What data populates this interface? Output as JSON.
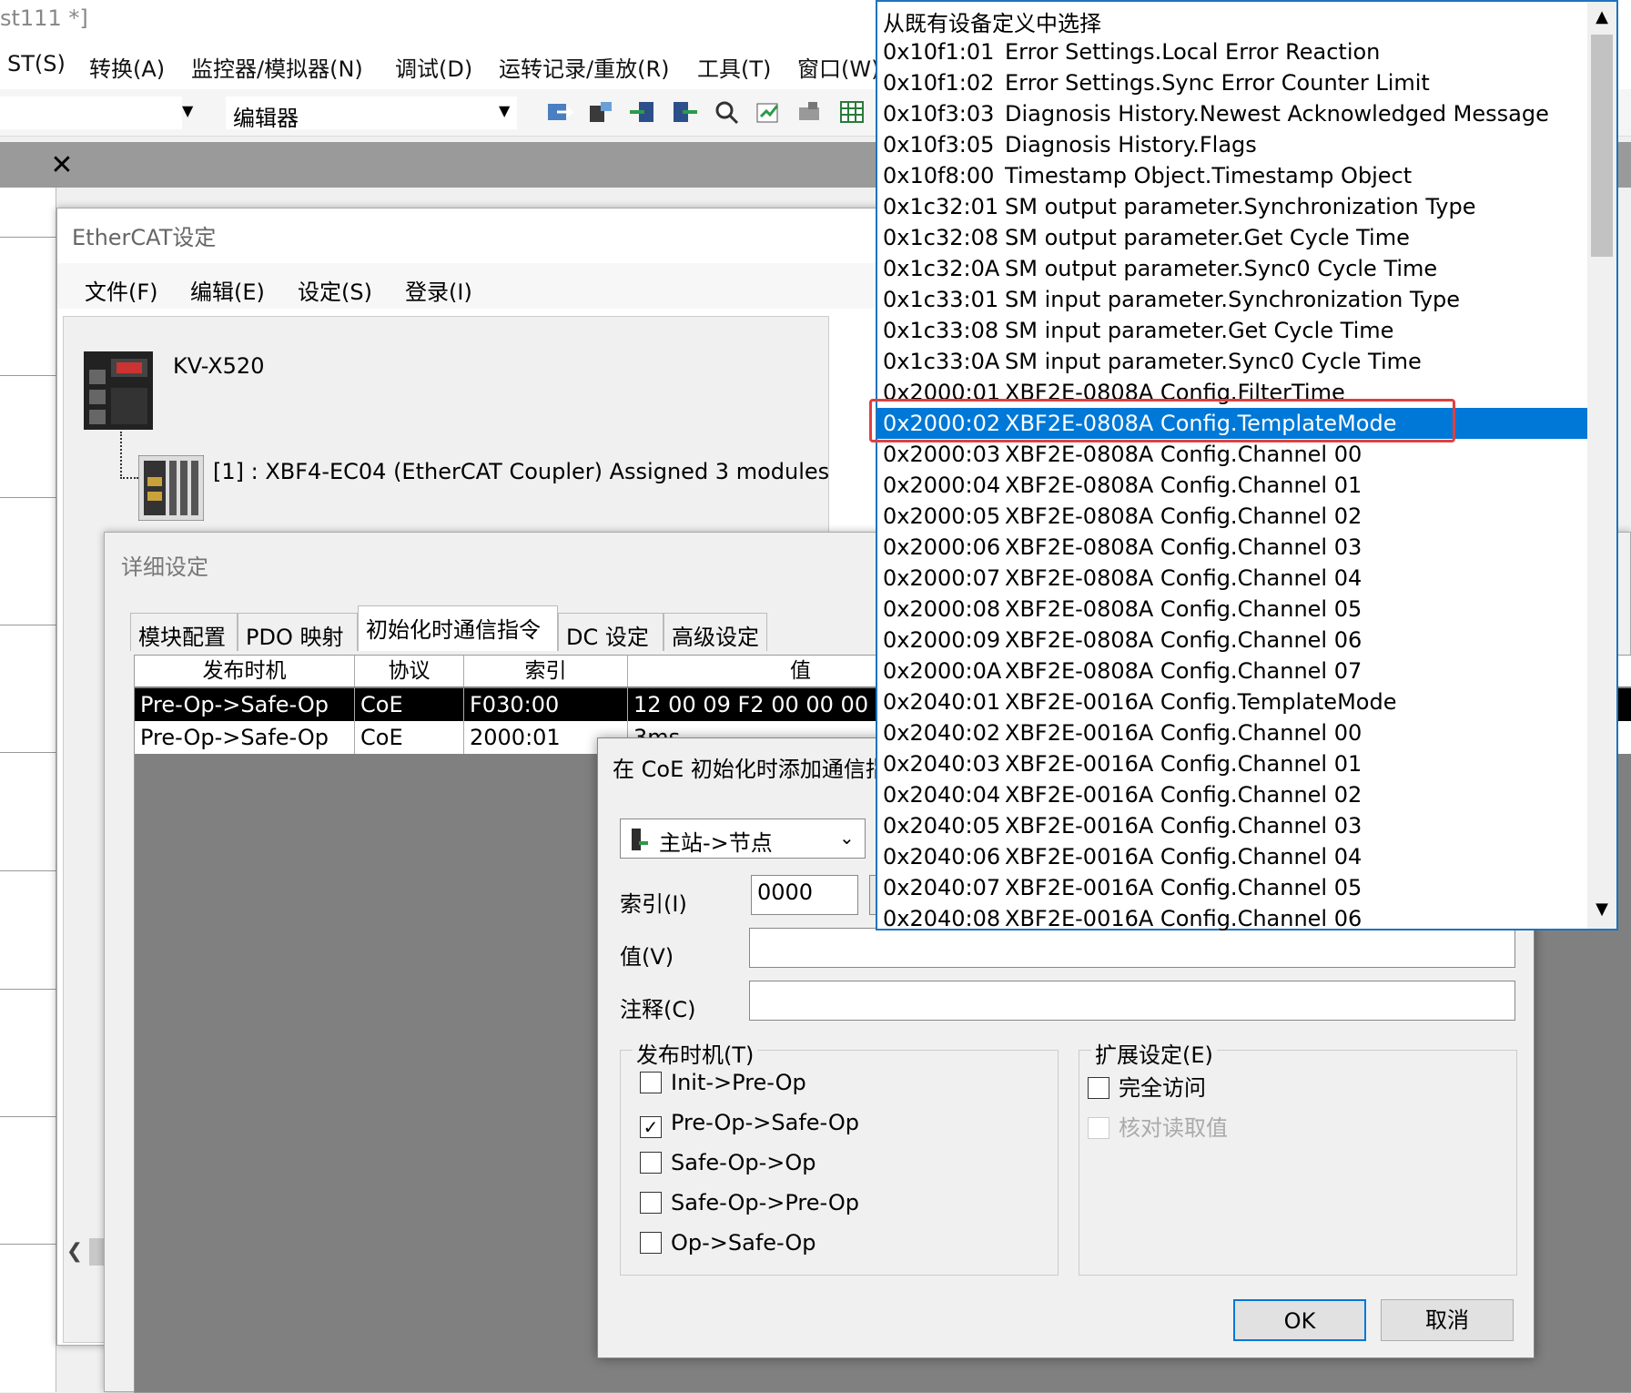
{
  "window": {
    "title_fragment": "st111 *]"
  },
  "menubar": {
    "items": [
      "ST(S)",
      "转换(A)",
      "监控器/模拟器(N)",
      "调试(D)",
      "运转记录/重放(R)",
      "工具(T)",
      "窗口(W)"
    ]
  },
  "toolbar": {
    "editor_combo": "编辑器"
  },
  "ethercat_window": {
    "title": "EtherCAT设定",
    "menu": [
      "文件(F)",
      "编辑(E)",
      "设定(S)",
      "登录(I)"
    ],
    "tree": {
      "plc": "KV-X520",
      "coupler": "[1] : XBF4-EC04 (EtherCAT Coupler) Assigned 3 modules"
    }
  },
  "detail_window": {
    "title": "详细设定",
    "tabs": [
      "模块配置",
      "PDO 映射",
      "初始化时通信指令",
      "DC 设定",
      "高级设定"
    ],
    "active_tab": "初始化时通信指令",
    "grid": {
      "headers": [
        "发布时机",
        "协议",
        "索引",
        "值"
      ],
      "rows": [
        [
          "Pre-Op->Safe-Op",
          "CoE",
          "F030:00",
          "12 00 09 F2 00 00 00 0"
        ],
        [
          "Pre-Op->Safe-Op",
          "CoE",
          "2000:01",
          "3ms"
        ]
      ]
    }
  },
  "command_dialog": {
    "title": "在 CoE 初始化时添加通信指",
    "direction": "主站->节点",
    "index_label": "索引(I)",
    "index_value": "0000",
    "value_label": "值(V)",
    "value_value": "",
    "comment_label": "注释(C)",
    "comment_value": "",
    "timing_group": "发布时机(T)",
    "timings": [
      {
        "label": "Init->Pre-Op",
        "checked": false
      },
      {
        "label": "Pre-Op->Safe-Op",
        "checked": true
      },
      {
        "label": "Safe-Op->Op",
        "checked": false
      },
      {
        "label": "Safe-Op->Pre-Op",
        "checked": false
      },
      {
        "label": "Op->Safe-Op",
        "checked": false
      }
    ],
    "ext_group": "扩展设定(E)",
    "ext_options": [
      {
        "label": "完全访问",
        "checked": false,
        "enabled": true
      },
      {
        "label": "核对读取值",
        "checked": false,
        "enabled": false
      }
    ],
    "ok": "OK",
    "cancel": "取消"
  },
  "dropdown": {
    "header": "从既有设备定义中选择",
    "selected": "0x2000:02",
    "items": [
      [
        "0x10f1:01",
        "Error Settings.Local Error Reaction"
      ],
      [
        "0x10f1:02",
        "Error Settings.Sync Error Counter Limit"
      ],
      [
        "0x10f3:03",
        "Diagnosis History.Newest Acknowledged Message"
      ],
      [
        "0x10f3:05",
        "Diagnosis History.Flags"
      ],
      [
        "0x10f8:00",
        "Timestamp Object.Timestamp Object"
      ],
      [
        "0x1c32:01",
        "SM output parameter.Synchronization Type"
      ],
      [
        "0x1c32:08",
        "SM output parameter.Get Cycle Time"
      ],
      [
        "0x1c32:0A",
        "SM output parameter.Sync0 Cycle Time"
      ],
      [
        "0x1c33:01",
        "SM input parameter.Synchronization Type"
      ],
      [
        "0x1c33:08",
        "SM input parameter.Get Cycle Time"
      ],
      [
        "0x1c33:0A",
        "SM input parameter.Sync0 Cycle Time"
      ],
      [
        "0x2000:01",
        "XBF2E-0808A Config.FilterTime"
      ],
      [
        "0x2000:02",
        "XBF2E-0808A Config.TemplateMode"
      ],
      [
        "0x2000:03",
        "XBF2E-0808A Config.Channel 00"
      ],
      [
        "0x2000:04",
        "XBF2E-0808A Config.Channel 01"
      ],
      [
        "0x2000:05",
        "XBF2E-0808A Config.Channel 02"
      ],
      [
        "0x2000:06",
        "XBF2E-0808A Config.Channel 03"
      ],
      [
        "0x2000:07",
        "XBF2E-0808A Config.Channel 04"
      ],
      [
        "0x2000:08",
        "XBF2E-0808A Config.Channel 05"
      ],
      [
        "0x2000:09",
        "XBF2E-0808A Config.Channel 06"
      ],
      [
        "0x2000:0A",
        "XBF2E-0808A Config.Channel 07"
      ],
      [
        "0x2040:01",
        "XBF2E-0016A Config.TemplateMode"
      ],
      [
        "0x2040:02",
        "XBF2E-0016A Config.Channel 00"
      ],
      [
        "0x2040:03",
        "XBF2E-0016A Config.Channel 01"
      ],
      [
        "0x2040:04",
        "XBF2E-0016A Config.Channel 02"
      ],
      [
        "0x2040:05",
        "XBF2E-0016A Config.Channel 03"
      ],
      [
        "0x2040:06",
        "XBF2E-0016A Config.Channel 04"
      ],
      [
        "0x2040:07",
        "XBF2E-0016A Config.Channel 05"
      ],
      [
        "0x2040:08",
        "XBF2E-0016A Config.Channel 06"
      ]
    ]
  },
  "colors": {
    "selection": "#0078d7",
    "highlight_box": "#e04040",
    "grid_bg": "#808080"
  }
}
